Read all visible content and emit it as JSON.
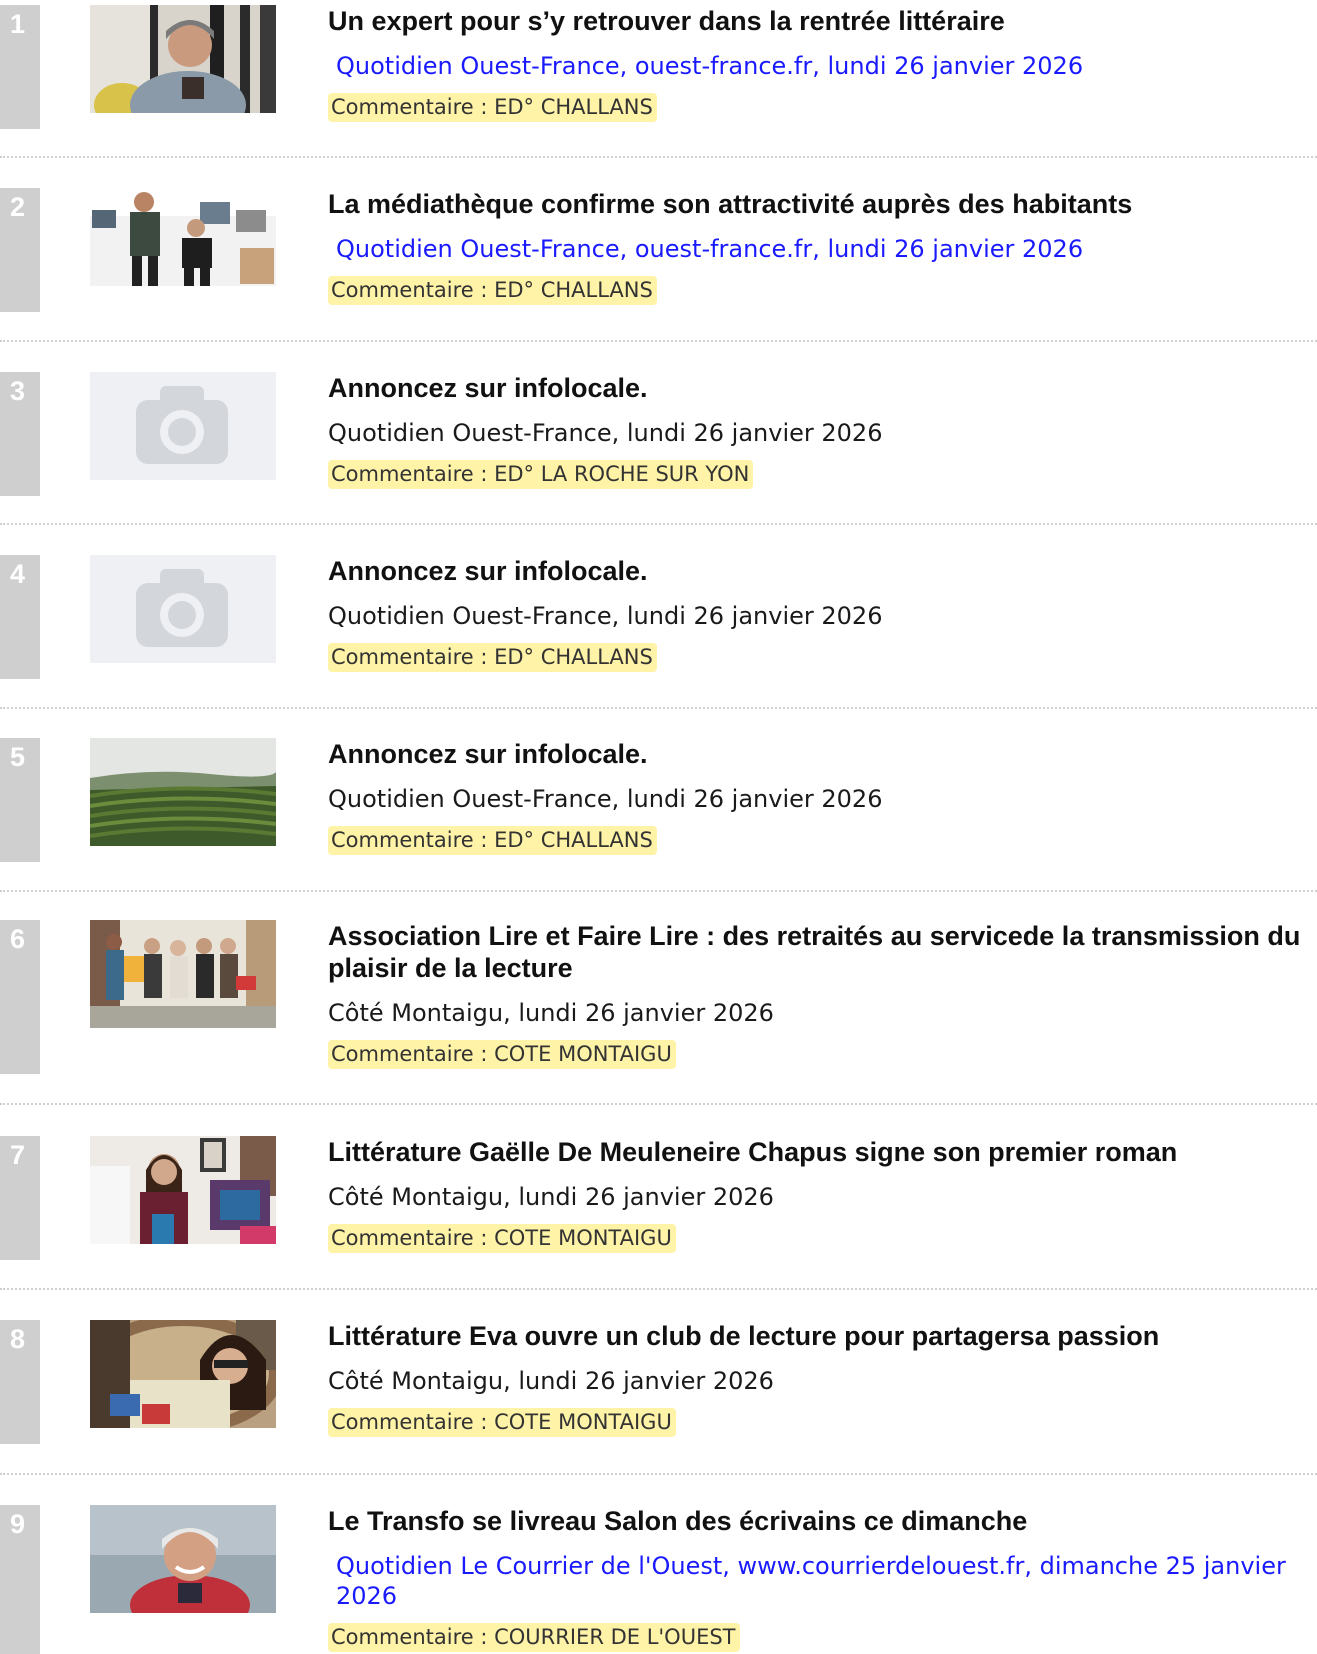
{
  "articles": [
    {
      "number": "1",
      "thumbnail": "photo-man-with-book",
      "title": "Un expert pour s’y retrouver dans la rentrée littéraire",
      "source": "Quotidien Ouest-France, ouest-france.fr, lundi 26 janvier 2026",
      "source_is_link": true,
      "comment": "Commentaire : ED° CHALLANS"
    },
    {
      "number": "2",
      "thumbnail": "photo-two-people-library",
      "title": "La médiathèque confirme son attractivité auprès des habitants",
      "source": "Quotidien Ouest-France, ouest-france.fr, lundi 26 janvier 2026",
      "source_is_link": true,
      "comment": "Commentaire : ED° CHALLANS"
    },
    {
      "number": "3",
      "thumbnail": "camera-placeholder-icon",
      "title": "Annoncez sur infolocale.",
      "source": "Quotidien Ouest-France, lundi 26 janvier 2026",
      "source_is_link": false,
      "comment": "Commentaire : ED° LA ROCHE SUR YON"
    },
    {
      "number": "4",
      "thumbnail": "camera-placeholder-icon",
      "title": "Annoncez sur infolocale.",
      "source": "Quotidien Ouest-France, lundi 26 janvier 2026",
      "source_is_link": false,
      "comment": "Commentaire : ED° CHALLANS"
    },
    {
      "number": "5",
      "thumbnail": "photo-green-terraced-fields",
      "title": "Annoncez sur infolocale.",
      "source": "Quotidien Ouest-France, lundi 26 janvier 2026",
      "source_is_link": false,
      "comment": "Commentaire : ED° CHALLANS"
    },
    {
      "number": "6",
      "thumbnail": "photo-group-with-books",
      "title": "Association Lire et Faire Lire : des retraités au servicede la transmission du plaisir de la lecture",
      "source": "Côté Montaigu, lundi 26 janvier 2026",
      "source_is_link": false,
      "comment": "Commentaire : COTE MONTAIGU"
    },
    {
      "number": "7",
      "thumbnail": "photo-woman-with-book",
      "title": "Littérature Gaëlle De Meuleneire Chapus signe son premier roman",
      "source": "Côté Montaigu, lundi 26 janvier 2026",
      "source_is_link": false,
      "comment": "Commentaire : COTE MONTAIGU"
    },
    {
      "number": "8",
      "thumbnail": "photo-woman-reading",
      "title": "Littérature Eva ouvre un club de lecture pour partagersa passion",
      "source": "Côté Montaigu, lundi 26 janvier 2026",
      "source_is_link": false,
      "comment": "Commentaire : COTE MONTAIGU"
    },
    {
      "number": "9",
      "thumbnail": "photo-smiling-man",
      "title": "Le Transfo se livreau Salon des écrivains ce dimanche",
      "source": "Quotidien Le Courrier de l'Ouest, www.courrierdelouest.fr, dimanche 25 janvier 2026",
      "source_is_link": true,
      "comment": "Commentaire : COURRIER DE L'OUEST"
    }
  ],
  "colors": {
    "number_tab": "#cfcfcf",
    "link": "#1a1aff",
    "comment_highlight": "#fff3a8",
    "separator": "#cfcfcf"
  }
}
